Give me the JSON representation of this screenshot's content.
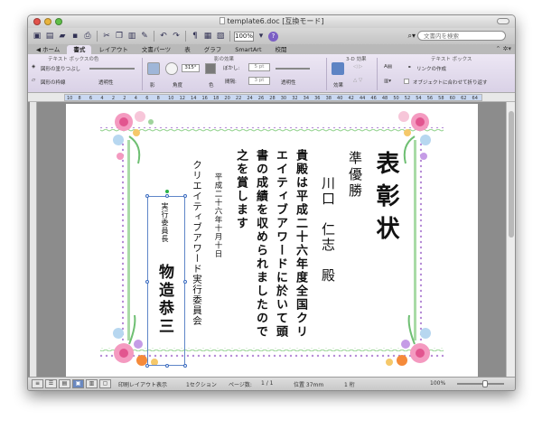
{
  "window": {
    "title": "template6.doc [互換モード]"
  },
  "toolbar": {
    "zoom": "100%",
    "search_placeholder": "文書内を検索"
  },
  "ribbon_tabs": [
    {
      "label": "ホーム"
    },
    {
      "label": "書式"
    },
    {
      "label": "レイアウト"
    },
    {
      "label": "文書パーツ"
    },
    {
      "label": "表"
    },
    {
      "label": "グラフ"
    },
    {
      "label": "SmartArt"
    },
    {
      "label": "校閲"
    }
  ],
  "ribbon": {
    "group_textbox_color": "テキスト ボックスの色",
    "shape_fill": "図形の塗りつぶし",
    "shape_line": "図形の枠線",
    "transparency": "透明性",
    "group_shadow": "影の効果",
    "shadow_label": "影",
    "angle_label": "角度",
    "angle_value": "315°",
    "color_label": "色",
    "blur_label": "ぼかし:",
    "blur_value": "5 pt",
    "distance_label": "間隔:",
    "distance_value": "3 pt",
    "transparency2": "透明性",
    "group_3d": "3-D 効果",
    "effect_label": "効果",
    "group_textbox": "テキスト ボックス",
    "link_label": "リンクの作成",
    "fit_label": "オブジェクトに合わせて折り返す"
  },
  "ruler": {
    "numbers": [
      "10",
      "8",
      "6",
      "4",
      "2",
      "2",
      "4",
      "6",
      "8",
      "10",
      "12",
      "14",
      "16",
      "18",
      "20",
      "22",
      "24",
      "26",
      "28",
      "30",
      "32",
      "34",
      "36",
      "38",
      "40",
      "42",
      "44",
      "46",
      "48",
      "50",
      "52",
      "54",
      "56",
      "58",
      "60",
      "62",
      "64"
    ]
  },
  "certificate": {
    "title": "表彰状",
    "award": "準優勝",
    "recipient": "川口　仁志　殿",
    "body_lines": [
      "貴殿は平成二十六年度全国クリ",
      "エイティブアワードに於いて頭",
      "書の成績を収められましたので",
      "之を賞します"
    ],
    "date": "平成二十六年十月十日",
    "organizer": "クリエイティブアワード実行委員会",
    "signer_role": "実行委員長",
    "signer_name": "物造恭三"
  },
  "statusbar": {
    "view_name": "印刷レイアウト表示",
    "section": "1セクション",
    "page_label": "ページ数:",
    "page_value": "1 / 1",
    "position": "位置 37mm",
    "column": "1 桁",
    "zoom": "100%"
  },
  "colors": {
    "ribbon_active_tab": "#e9e3f2",
    "selection_border": "#5f86c8",
    "frame_purple": "#b58ad6",
    "frame_green": "#8fd18a"
  }
}
